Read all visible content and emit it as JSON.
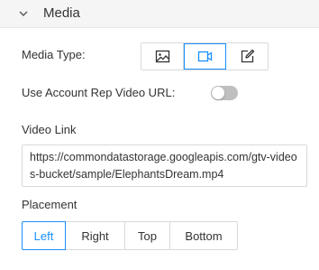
{
  "section": {
    "title": "Media",
    "collapse_icon": "chevron-down-icon"
  },
  "media_type": {
    "label": "Media Type",
    "options": [
      {
        "icon": "image-icon",
        "selected": false
      },
      {
        "icon": "video-icon",
        "selected": true
      },
      {
        "icon": "edit-icon",
        "selected": false
      }
    ]
  },
  "account_rep_video": {
    "label": "Use Account Rep Video URL",
    "enabled": false
  },
  "video_link": {
    "label": "Video Link",
    "value": "https://commondatastorage.googleapis.com/gtv-videos-bucket/sample/ElephantsDream.mp4"
  },
  "placement": {
    "label": "Placement",
    "options": [
      "Left",
      "Right",
      "Top",
      "Bottom"
    ],
    "selected": "Left"
  },
  "colors": {
    "accent": "#1890ff",
    "border": "#d9d9d9",
    "header_bg": "#f5f5f5",
    "toggle_off": "#bfbfbf"
  }
}
